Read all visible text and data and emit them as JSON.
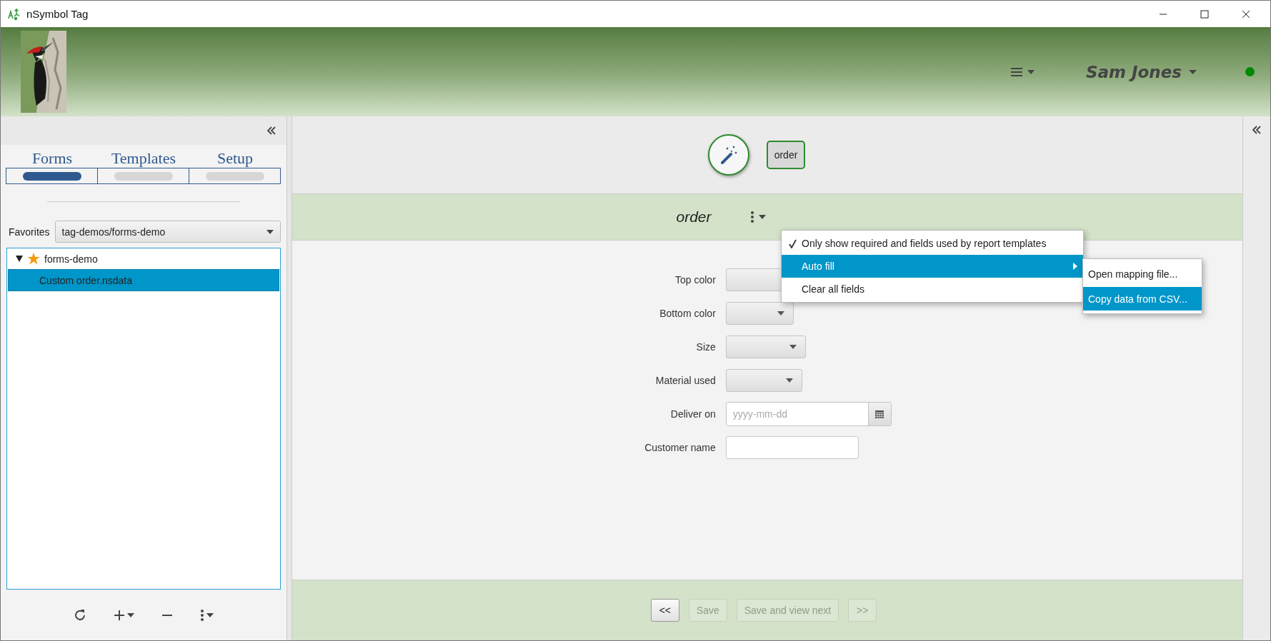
{
  "window": {
    "title": "nSymbol Tag"
  },
  "header": {
    "user": "Sam Jones"
  },
  "tabs": [
    {
      "label": "Forms",
      "selected": true
    },
    {
      "label": "Templates",
      "selected": false
    },
    {
      "label": "Setup",
      "selected": false
    }
  ],
  "favorites": {
    "label": "Favorites",
    "value": "tag-demos/forms-demo"
  },
  "tree": [
    {
      "label": "forms-demo",
      "favorite": true,
      "expanded": true,
      "selected": false,
      "children": [
        {
          "label": "Custom order.nsdata",
          "selected": true
        }
      ]
    }
  ],
  "form": {
    "title": "order",
    "chip": "order",
    "fields": [
      {
        "label": "Top color",
        "kind": "combo"
      },
      {
        "label": "Bottom color",
        "kind": "combo"
      },
      {
        "label": "Size",
        "kind": "combo"
      },
      {
        "label": "Material used",
        "kind": "combo"
      },
      {
        "label": "Deliver on",
        "kind": "date",
        "placeholder": "yyyy-mm-dd"
      },
      {
        "label": "Customer name",
        "kind": "text"
      }
    ]
  },
  "menu": [
    {
      "label": "Only show required and fields used by report templates",
      "checked": true,
      "selected": false,
      "submenu": false
    },
    {
      "label": "Auto fill",
      "checked": false,
      "selected": true,
      "submenu": true
    },
    {
      "label": "Clear all fields",
      "checked": false,
      "selected": false,
      "submenu": false
    }
  ],
  "submenu": [
    {
      "label": "Open mapping file...",
      "selected": false
    },
    {
      "label": "Copy data from CSV...",
      "selected": true
    }
  ],
  "footer_buttons": [
    {
      "label": "<<",
      "disabled": false
    },
    {
      "label": "Save",
      "disabled": true
    },
    {
      "label": "Save and view next",
      "disabled": true
    },
    {
      "label": ">>",
      "disabled": true
    }
  ]
}
